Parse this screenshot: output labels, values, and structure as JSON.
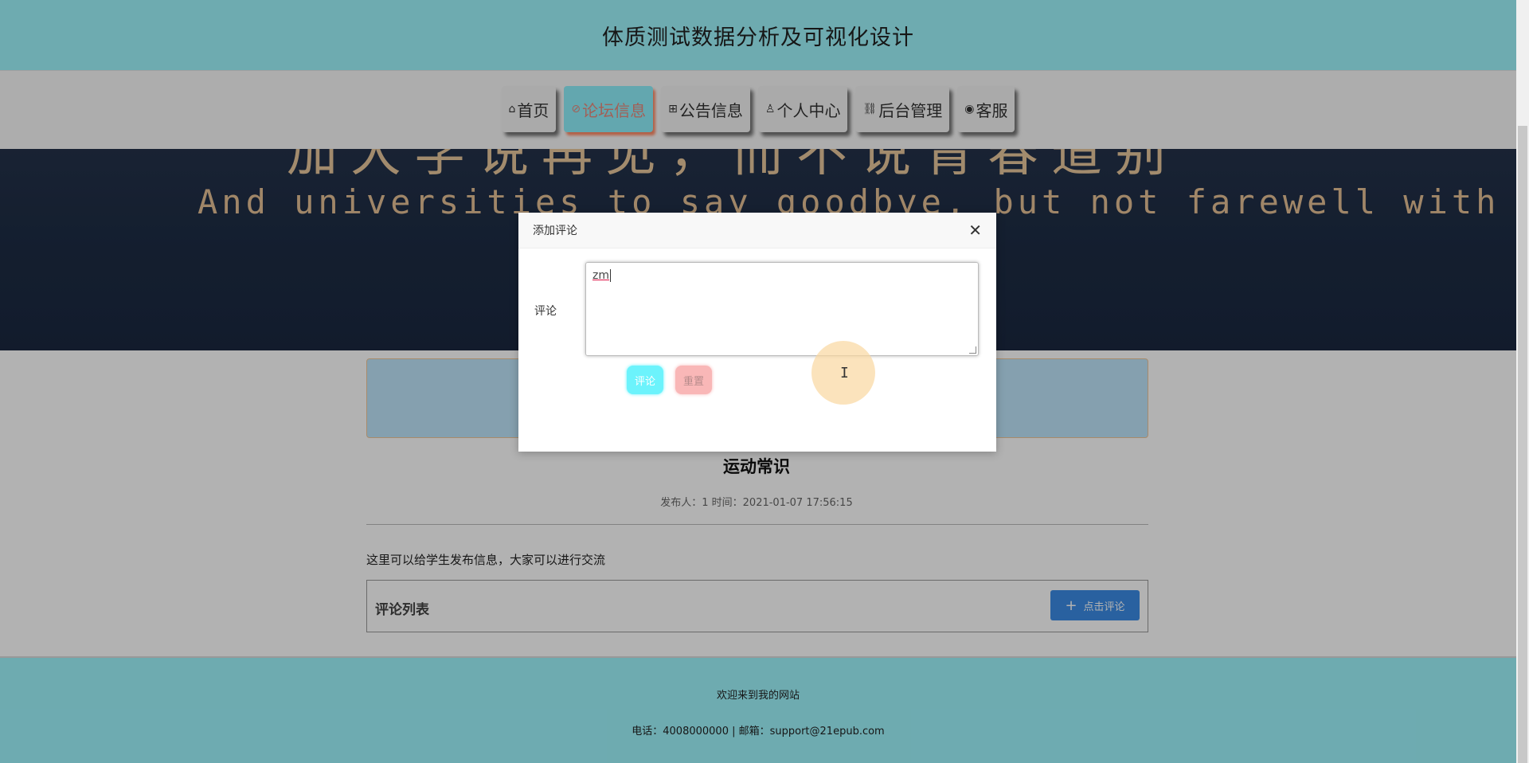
{
  "header": {
    "title": "体质测试数据分析及可视化设计"
  },
  "nav": {
    "items": [
      {
        "icon": "⌂",
        "label": "首页"
      },
      {
        "icon": "⊘",
        "label": "论坛信息"
      },
      {
        "icon": "⊞",
        "label": "公告信息"
      },
      {
        "icon": "♙",
        "label": "个人中心"
      },
      {
        "icon": "⛓",
        "label": "后台管理"
      },
      {
        "icon": "◉",
        "label": "客服"
      }
    ]
  },
  "banner": {
    "chinese_text": "加大学说再见，而不说青春道别",
    "english_text": "And universities to say goodbye, but not farewell with youth"
  },
  "post": {
    "title": "运动常识",
    "meta": "发布人：1 时间：2021-01-07 17:56:15",
    "body": "这里可以给学生发布信息，大家可以进行交流"
  },
  "comment_list": {
    "title": "评论列表",
    "add_button_label": "点击评论",
    "add_button_icon": "+"
  },
  "footer": {
    "welcome": "欢迎来到我的网站",
    "contact": "电话：4008000000 | 邮箱：support@21epub.com"
  },
  "modal": {
    "title": "添加评论",
    "close_icon": "✕",
    "field_label": "评论",
    "textarea_value": "zm",
    "submit_label": "评论",
    "reset_label": "重置",
    "cursor_glyph": "I"
  },
  "colors": {
    "header_bg": "#9ef5fd",
    "active_nav_bg": "#8ff0fb",
    "active_nav_text": "#e98a7d",
    "submit_btn": "#6cf3fc",
    "reset_btn": "#f9b7b7",
    "add_comment_btn": "#3b8ce5"
  }
}
